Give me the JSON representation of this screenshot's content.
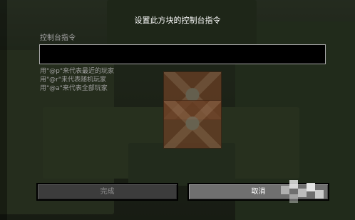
{
  "dialog": {
    "title": "设置此方块的控制台指令",
    "input_label": "控制台指令",
    "command_value": "",
    "hints": [
      "用\"@p\"来代表最近的玩家",
      "用\"@r\"来代表随机玩家",
      "用\"@a\"来代表全部玩家"
    ]
  },
  "buttons": {
    "done_label": "完成",
    "cancel_label": "取消"
  },
  "colors": {
    "title_text": "#ffffff",
    "label_text": "#a0a0a0",
    "input_bg": "#000000",
    "button_disabled_bg": "#3c3c3c",
    "button_active_bg": "#6f6f6f"
  },
  "icons": {
    "background_block": "command-block-icon"
  }
}
